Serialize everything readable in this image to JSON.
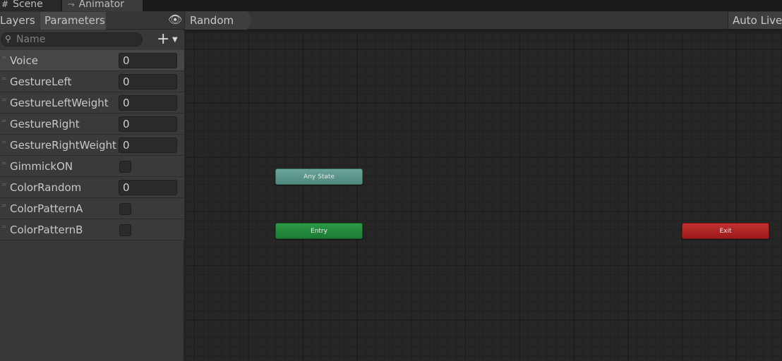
{
  "window_tabs": [
    {
      "label": "Scene",
      "icon": "grid-icon"
    },
    {
      "label": "Animator",
      "icon": "animator-icon"
    }
  ],
  "left_panel": {
    "tabs": {
      "layers": "Layers",
      "parameters": "Parameters"
    },
    "search": {
      "placeholder": "Name"
    },
    "parameters": [
      {
        "name": "Voice",
        "type": "float",
        "value": "0"
      },
      {
        "name": "GestureLeft",
        "type": "int",
        "value": "0"
      },
      {
        "name": "GestureLeftWeight",
        "type": "float",
        "value": "0"
      },
      {
        "name": "GestureRight",
        "type": "int",
        "value": "0"
      },
      {
        "name": "GestureRightWeight",
        "type": "float",
        "value": "0"
      },
      {
        "name": "GimmickON",
        "type": "bool",
        "checked": false
      },
      {
        "name": "ColorRandom",
        "type": "int",
        "value": "0"
      },
      {
        "name": "ColorPatternA",
        "type": "bool",
        "checked": false
      },
      {
        "name": "ColorPatternB",
        "type": "bool",
        "checked": false
      }
    ]
  },
  "graph": {
    "breadcrumb": "Random",
    "auto_live": "Auto Live",
    "nodes": {
      "any_state": "Any State",
      "entry": "Entry",
      "exit": "Exit"
    }
  },
  "colors": {
    "any_state": "#5f9a8f",
    "entry": "#248a3c",
    "exit": "#b02424"
  }
}
